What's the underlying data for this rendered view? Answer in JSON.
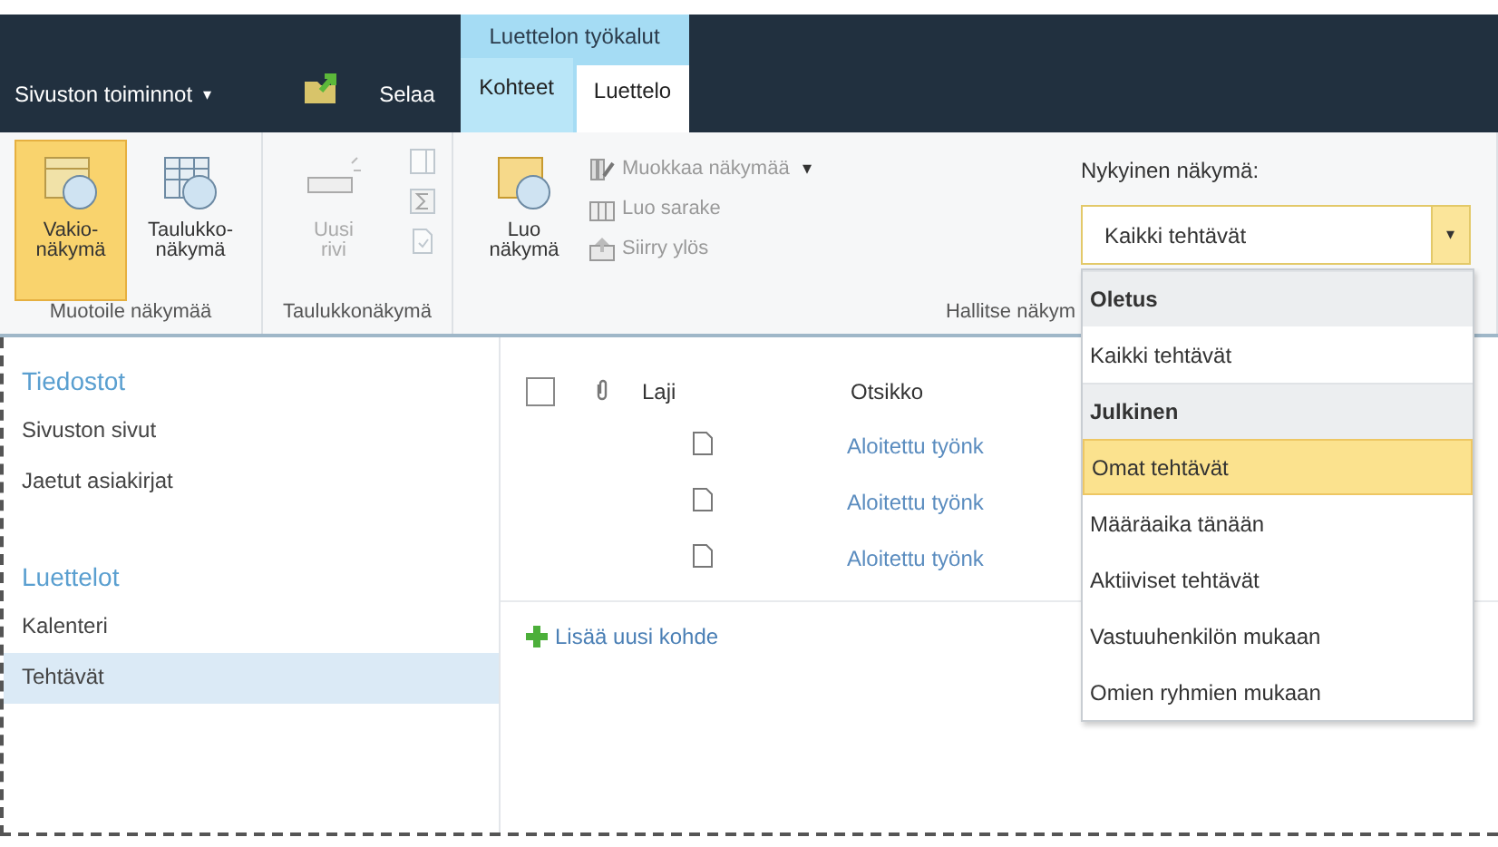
{
  "top_bar": {
    "site_actions": "Sivuston toiminnot",
    "site_actions_caret": "▾",
    "browse_tab": {
      "label": "Selaa",
      "selected": false
    },
    "context_group": "Luettelon työkalut",
    "tabs": [
      {
        "label": "Kohteet",
        "selected": false
      },
      {
        "label": "Luettelo",
        "selected": true
      }
    ]
  },
  "ribbon": {
    "groups": [
      {
        "label": "Muotoile näkymää",
        "items": [
          {
            "kind": "large",
            "lines": [
              "Vakio-",
              "näkymä"
            ],
            "selected": true,
            "disabled": false
          },
          {
            "kind": "large",
            "lines": [
              "Taulukko-",
              "näkymä"
            ],
            "selected": false,
            "disabled": false
          }
        ]
      },
      {
        "label": "Taulukkonäkymä",
        "items": [
          {
            "kind": "large",
            "lines": [
              "Uusi",
              "rivi"
            ],
            "selected": false,
            "disabled": true
          },
          {
            "kind": "icons",
            "buttons": [
              {
                "disabled": true
              },
              {
                "disabled": true
              },
              {
                "disabled": true
              }
            ]
          }
        ]
      },
      {
        "label": "Hallitse näkym",
        "items": [
          {
            "kind": "large",
            "lines": [
              "Luo",
              "näkymä"
            ],
            "selected": false,
            "disabled": false
          },
          {
            "kind": "small",
            "entries": [
              {
                "label": "Muokkaa näkymää",
                "caret": "▾",
                "disabled": true
              },
              {
                "label": "Luo sarake",
                "disabled": true
              },
              {
                "label": "Siirry ylös",
                "disabled": true
              }
            ]
          },
          {
            "kind": "view_select",
            "label": "Nykyinen näkymä:",
            "value": "Kaikki tehtävät",
            "arrow": "▾",
            "expanded": true,
            "options": [
              {
                "kind": "header",
                "label": "Oletus"
              },
              {
                "kind": "option",
                "label": "Kaikki tehtävät",
                "highlighted": false
              },
              {
                "kind": "header",
                "label": "Julkinen"
              },
              {
                "kind": "option",
                "label": "Omat tehtävät",
                "highlighted": true
              },
              {
                "kind": "option",
                "label": "Määräaika tänään",
                "highlighted": false
              },
              {
                "kind": "option",
                "label": "Aktiiviset tehtävät",
                "highlighted": false
              },
              {
                "kind": "option",
                "label": "Vastuuhenkilön mukaan",
                "highlighted": false
              },
              {
                "kind": "option",
                "label": "Omien ryhmien mukaan",
                "highlighted": false
              }
            ]
          }
        ]
      }
    ]
  },
  "sidebar": {
    "sections": [
      {
        "heading": "Tiedostot",
        "items": [
          {
            "label": "Sivuston sivut",
            "selected": false
          },
          {
            "label": "Jaetut asiakirjat",
            "selected": false
          }
        ]
      },
      {
        "heading": "Luettelot",
        "items": [
          {
            "label": "Kalenteri",
            "selected": false
          },
          {
            "label": "Tehtävät",
            "selected": true
          }
        ]
      }
    ]
  },
  "list": {
    "select_all": {
      "checked": false
    },
    "columns": [
      "Laji",
      "Otsikko"
    ],
    "rows": [
      {
        "title": "Aloitettu työnk"
      },
      {
        "title": "Aloitettu työnk"
      },
      {
        "title": "Aloitettu työnk"
      }
    ],
    "add_link": "Lisää uusi kohde"
  }
}
